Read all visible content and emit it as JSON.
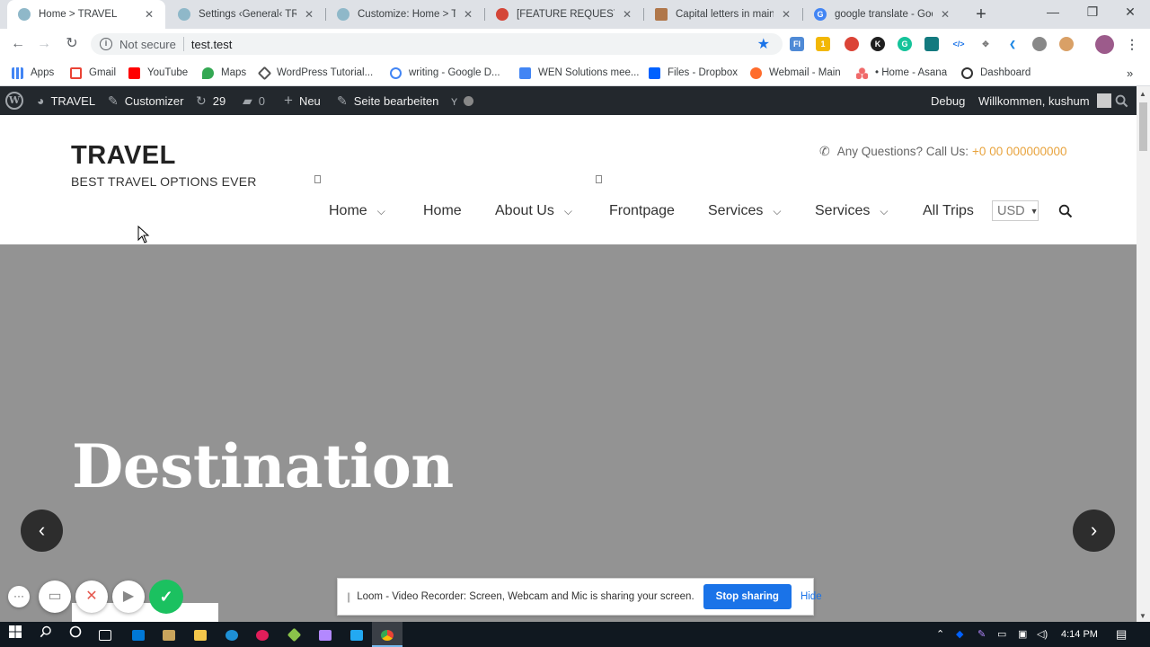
{
  "browser": {
    "tabs": [
      {
        "title": "Home > TRAVEL",
        "active": true,
        "fav_color": "#8fb8c9"
      },
      {
        "title": "Settings ‹General‹ TRAV",
        "active": false,
        "fav_color": "#8fb8c9"
      },
      {
        "title": "Customize: Home > TR",
        "active": false,
        "fav_color": "#8fb8c9"
      },
      {
        "title": "[FEATURE REQUEST] Lo",
        "active": false,
        "fav_color": "#d44638"
      },
      {
        "title": "Capital letters in main m",
        "active": false,
        "fav_color": "#b0774a"
      },
      {
        "title": "google translate - Goo",
        "active": false,
        "fav_color": "#4285f4"
      }
    ],
    "new_tab": "+",
    "window_controls": {
      "minimize": "—",
      "restore": "❐",
      "close": "✕"
    },
    "omnibox": {
      "security": "Not secure",
      "url": "test.test"
    },
    "bookmarks": [
      {
        "label": "Apps",
        "color": "#4285f4"
      },
      {
        "label": "Gmail",
        "color": "#ea4335"
      },
      {
        "label": "YouTube",
        "color": "#ff0000"
      },
      {
        "label": "Maps",
        "color": "#34a853"
      },
      {
        "label": "WordPress Tutorial...",
        "color": "#555555"
      },
      {
        "label": "writing - Google D...",
        "color": "#4285f4"
      },
      {
        "label": "WEN Solutions mee...",
        "color": "#4285f4"
      },
      {
        "label": "Files - Dropbox",
        "color": "#0061ff"
      },
      {
        "label": "Webmail - Main",
        "color": "#ff6c2c"
      },
      {
        "label": "• Home - Asana",
        "color": "#f06a6a"
      },
      {
        "label": "Dashboard",
        "color": "#333333"
      }
    ],
    "bookmarks_more": "»"
  },
  "adminbar": {
    "site_name": "TRAVEL",
    "customizer": "Customizer",
    "updates_count": "29",
    "comments_count": "0",
    "new_label": "Neu",
    "edit_page": "Seite bearbeiten",
    "debug": "Debug",
    "welcome": "Willkommen, kushum"
  },
  "site": {
    "title": "TRAVEL",
    "tagline": "BEST TRAVEL OPTIONS EVER",
    "contact_label": "Any Questions? Call Us:",
    "contact_number": "+0 00 000000000",
    "accent_color": "#e8a33d",
    "menu": [
      {
        "label": "Home",
        "has_dropdown": true
      },
      {
        "label": "Home",
        "has_dropdown": false
      },
      {
        "label": "About Us",
        "has_dropdown": true
      },
      {
        "label": "Frontpage",
        "has_dropdown": false
      },
      {
        "label": "Services",
        "has_dropdown": true
      },
      {
        "label": "Services",
        "has_dropdown": true
      },
      {
        "label": "All Trips",
        "has_dropdown": false
      }
    ],
    "currency": "USD"
  },
  "hero": {
    "title": "Destination",
    "prev": "‹",
    "next": "›",
    "background": "#939393"
  },
  "loom": {
    "share_message": "Loom - Video Recorder: Screen, Webcam and Mic is sharing your screen.",
    "stop_sharing": "Stop sharing",
    "hide": "Hide"
  },
  "taskbar": {
    "time": "4:14 PM"
  }
}
